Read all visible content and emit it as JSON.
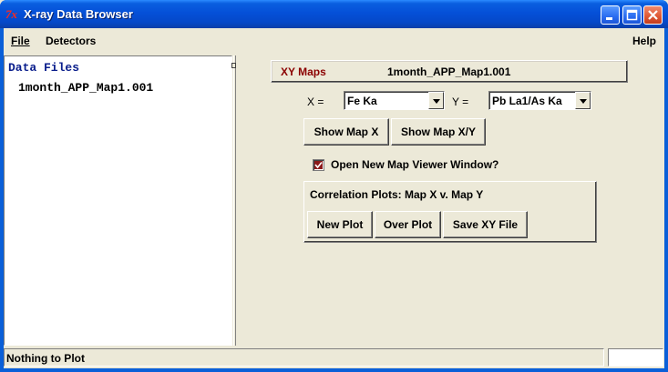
{
  "window": {
    "title": "X-ray Data Browser",
    "app_icon_glyph": "7x"
  },
  "menu": {
    "file": "File",
    "detectors": "Detectors",
    "help": "Help"
  },
  "data_files": {
    "heading": "Data Files",
    "items": [
      "1month_APP_Map1.001"
    ]
  },
  "xy_maps": {
    "label": "XY Maps",
    "filename": "1month_APP_Map1.001",
    "x_label": "X =",
    "x_value": "Fe Ka",
    "y_label": "Y =",
    "y_value": "Pb La1/As Ka",
    "show_map_x": "Show Map X",
    "show_map_xy": "Show Map X/Y",
    "new_window_checkbox": "Open New Map Viewer Window?",
    "new_window_checked": true,
    "correlation_title": "Correlation Plots: Map X v. Map Y",
    "new_plot": "New Plot",
    "over_plot": "Over Plot",
    "save_xy_file": "Save XY File"
  },
  "status": {
    "text": "Nothing to Plot"
  },
  "colors": {
    "accent_red": "#8b0000",
    "heading_blue": "#0a1e8c",
    "titlebar_blue": "#0550d8"
  }
}
